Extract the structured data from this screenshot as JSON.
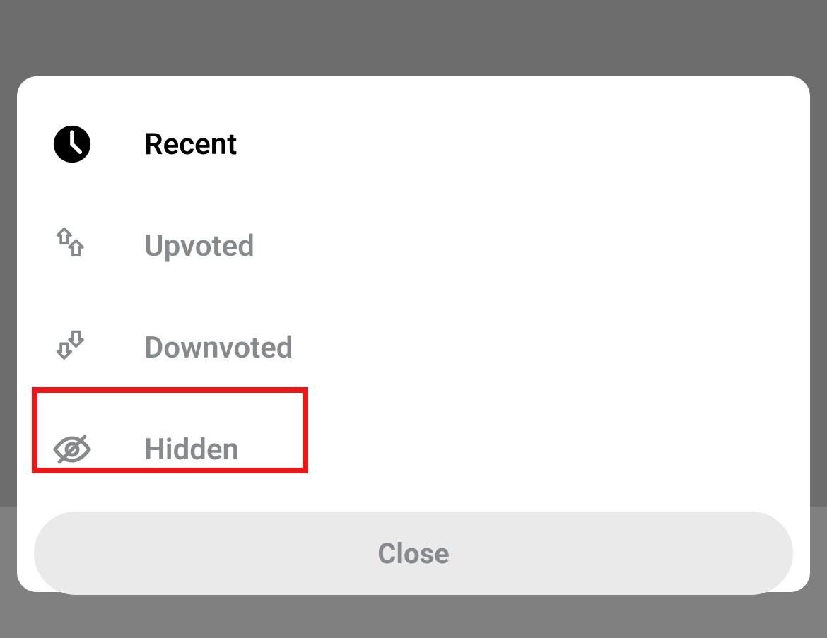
{
  "modal": {
    "options": [
      {
        "label": "Recent",
        "icon": "clock-icon",
        "selected": true
      },
      {
        "label": "Upvoted",
        "icon": "upvote-icon",
        "selected": false
      },
      {
        "label": "Downvoted",
        "icon": "downvote-icon",
        "selected": false
      },
      {
        "label": "Hidden",
        "icon": "hidden-icon",
        "selected": false
      }
    ],
    "close_label": "Close"
  }
}
